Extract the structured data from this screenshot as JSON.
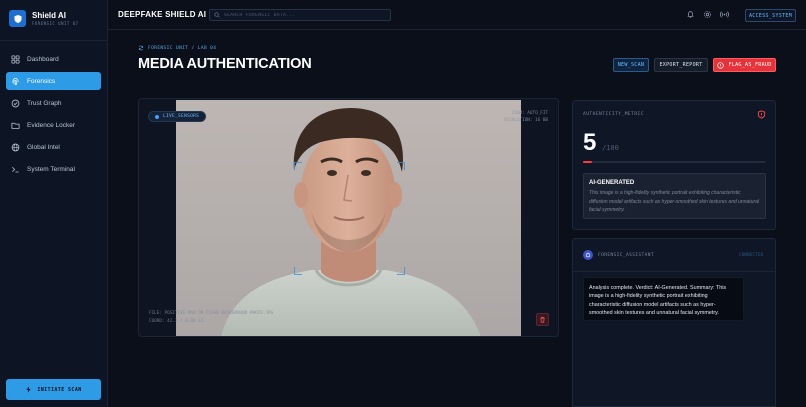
{
  "brand": {
    "name": "Shield AI",
    "subtitle": "FORENSIC UNIT 07"
  },
  "sidebar": {
    "items": [
      {
        "label": "Dashboard",
        "icon": "grid-icon",
        "active": false
      },
      {
        "label": "Forensics",
        "icon": "fingerprint-icon",
        "active": true
      },
      {
        "label": "Trust Graph",
        "icon": "graph-icon",
        "active": false
      },
      {
        "label": "Evidence Locker",
        "icon": "folder-icon",
        "active": false
      },
      {
        "label": "Global Intel",
        "icon": "globe-icon",
        "active": false
      },
      {
        "label": "System Terminal",
        "icon": "terminal-icon",
        "active": false
      }
    ],
    "initiate_label": "INITIATE SCAN"
  },
  "topbar": {
    "title": "DEEPFAKE SHIELD AI",
    "search_placeholder": "SEARCH FORENSIC DATA...",
    "access_label": "ACCESS_SYSTEM"
  },
  "header": {
    "breadcrumb": "FORENSIC UNIT / LAB 04",
    "title": "MEDIA AUTHENTICATION",
    "new_scan": "NEW_SCAN",
    "export": "EXPORT_REPORT",
    "flag": "FLAG_AS_FRAUD"
  },
  "media": {
    "live_label": "LIVE_SENSORS",
    "zoom": "ZOOM: AUTO_FIT",
    "resolution": "RESOLUTION: 16 BB",
    "file": "FILE: POSITIVE MAN ON CLEAN BACKGROUND PHOTO.JPG",
    "coords": "COORD: 42.3 / 0.00.42"
  },
  "metric": {
    "title": "AUTHENTICITY_METRIC",
    "score": "5",
    "max": "/100",
    "score_fraction": 0.05,
    "verdict_label": "AI-GENERATED",
    "verdict_text": "This image is a high-fidelity synthetic portrait exhibiting characteristic diffusion model artifacts such as hyper-smoothed skin textures and unnatural facial symmetry."
  },
  "assistant": {
    "title": "FORENSIC_ASSISTANT",
    "status": "CONNECTED",
    "message": "Analysis complete. Verdict: AI-Generated. Summary: This image is a high-fidelity synthetic portrait exhibiting characteristic diffusion model artifacts such as hyper-smoothed skin textures and unnatural facial symmetry."
  },
  "colors": {
    "accent": "#2e9be6",
    "danger": "#e5333b",
    "background": "#0a0f1a",
    "panel": "#0f1626"
  }
}
